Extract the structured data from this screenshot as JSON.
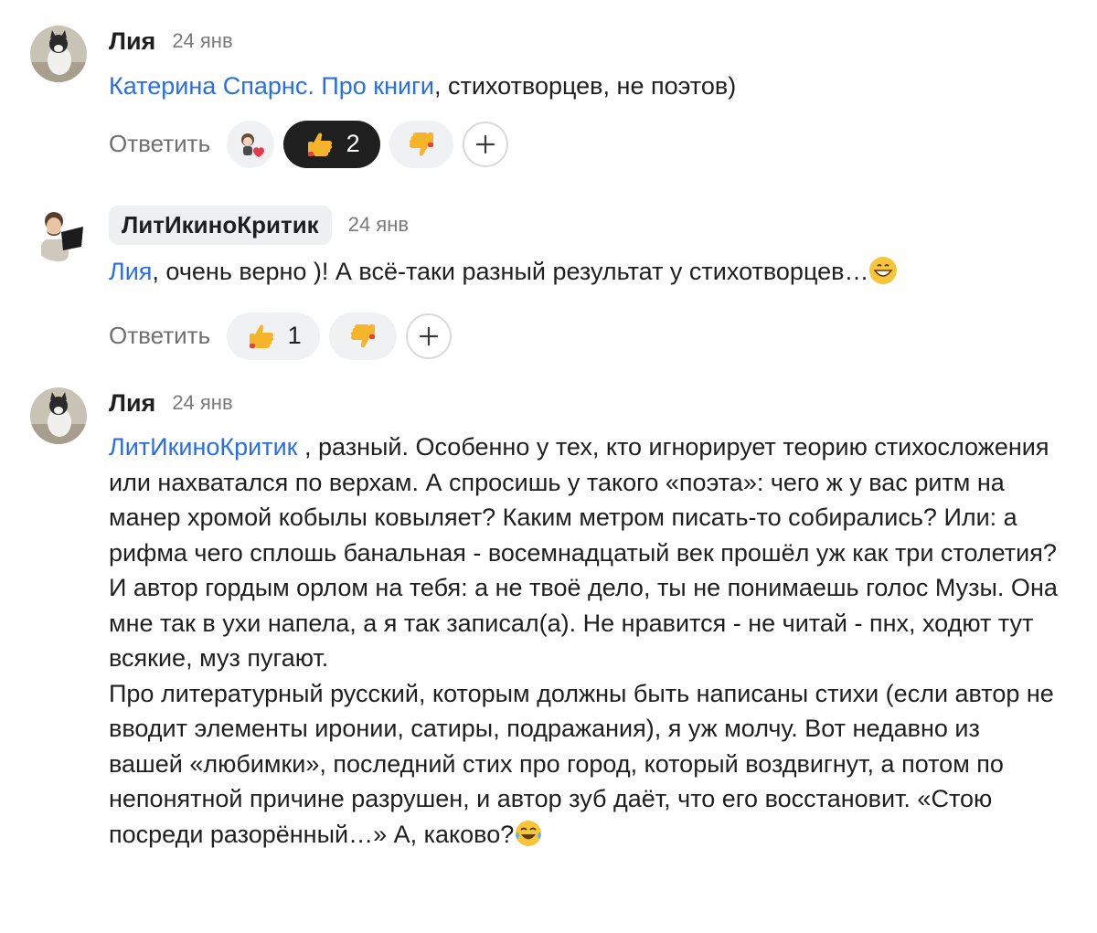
{
  "comments": [
    {
      "author": "Лия",
      "date": "24 янв",
      "text_parts": [
        {
          "mention": "Катерина Спарнс. Про книги"
        },
        {
          "text": ", стихотворцев, не поэтов)"
        }
      ],
      "reply_label": "Ответить",
      "reactions": {
        "like_count": "2"
      }
    },
    {
      "author": "ЛитИкиноКритик",
      "date": "24 янв",
      "text_parts": [
        {
          "mention": "Лия"
        },
        {
          "text": ", очень верно )! А всё-таки разный результат у стихотворцев…"
        }
      ],
      "reply_label": "Ответить",
      "reactions": {
        "like_count": "1"
      }
    },
    {
      "author": "Лия",
      "date": "24 янв",
      "text_parts": [
        {
          "mention": "ЛитИкиноКритик"
        },
        {
          "text": " , разный. Особенно у тех, кто игнорирует теорию стихосложения или нахватался по верхам. А спросишь у такого «поэта»: чего ж у вас ритм на манер хромой кобылы ковыляет? Каким метром писать-то собирались? Или: а рифма чего сплошь банальная - восемнадцатый век прошёл уж как три столетия? И автор гордым орлом на тебя: а не твоё дело, ты не понимаешь голос Музы. Она мне так в ухи напела, а я так записал(а). Не нравится - не читай - пнх, ходют тут всякие, муз пугают."
        },
        {
          "text2": "Про литературный русский, которым должны быть написаны стихи (если автор не вводит элементы иронии, сатиры, подражания), я уж молчу. Вот недавно из вашей «любимки», последний стих про город, который воздвигнут, а потом по непонятной причине разрушен, и автор зуб даёт, что его восстановит. «Стою посреди разорённый…» А, каково?"
        }
      ]
    }
  ],
  "icons": {
    "like": "thumbs-up-icon",
    "dislike": "thumbs-down-icon",
    "add": "plus-icon",
    "custom_reaction": "heart-sticker-icon",
    "grin": "grinning-emoji-icon",
    "laugh": "tears-of-joy-emoji-icon"
  },
  "colors": {
    "mention": "#2a6ee6",
    "active_pill": "#1f1f1f",
    "pill": "#f0f1f3",
    "thumb": "#f6b42b",
    "thumb_down_accent": "#e2452f"
  }
}
